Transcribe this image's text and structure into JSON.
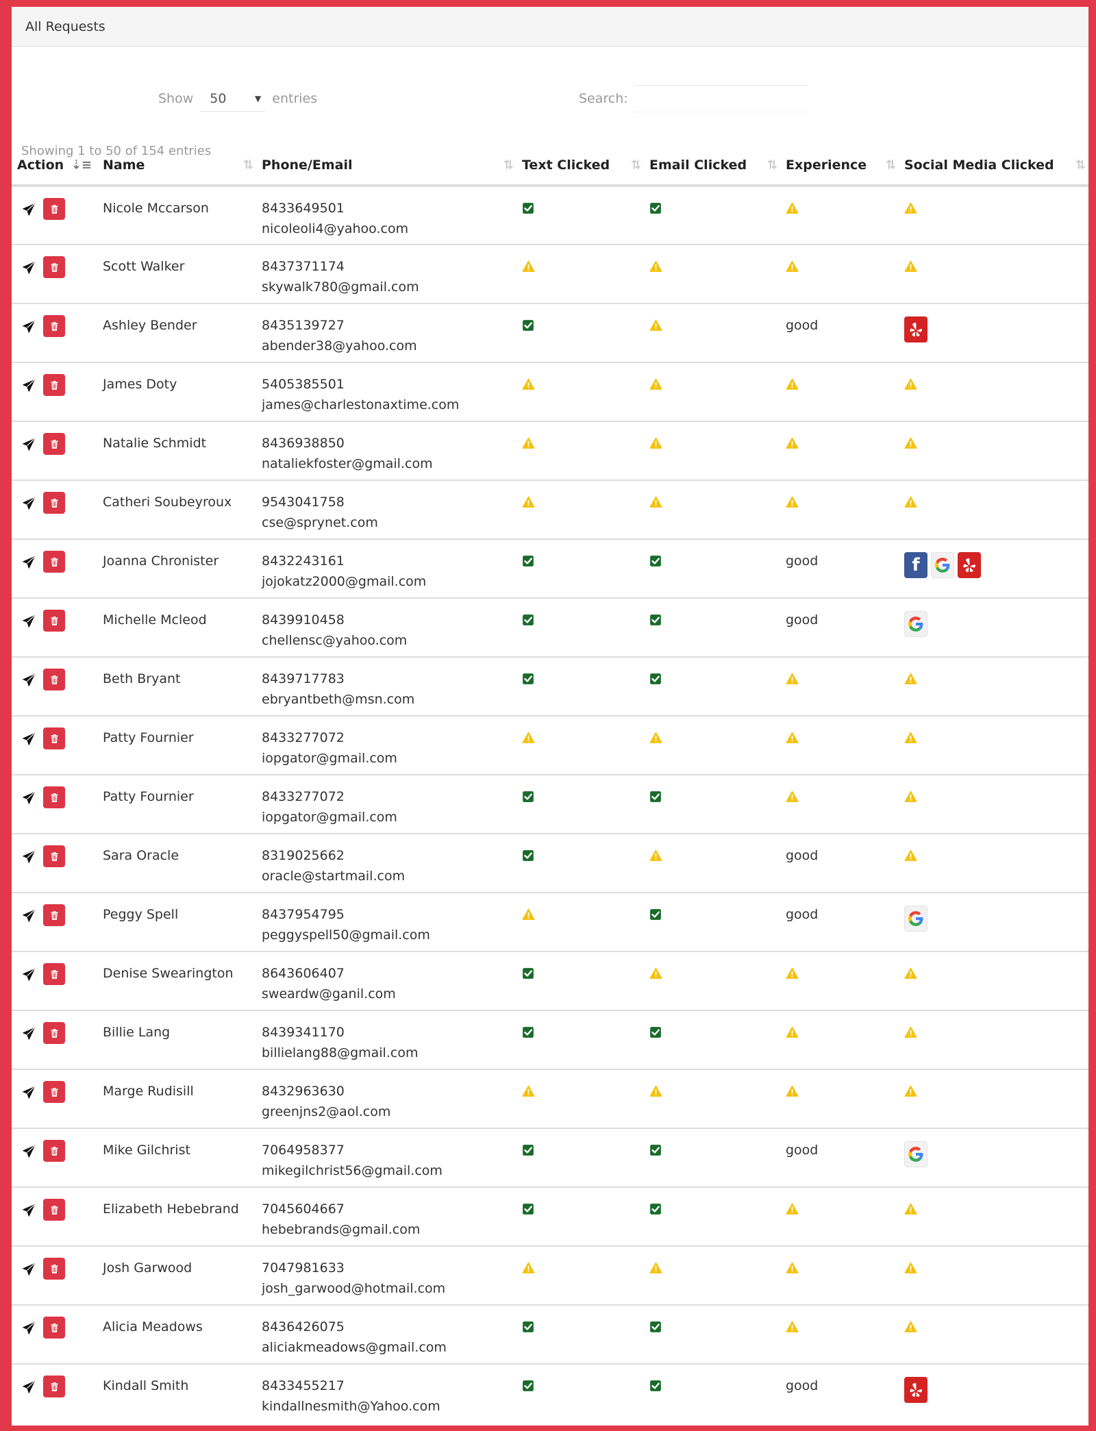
{
  "panel": {
    "title": "All Requests"
  },
  "controls": {
    "show_label": "Show",
    "length_value": "50",
    "entries_label": "entries",
    "search_label": "Search:",
    "search_value": "",
    "info": "Showing 1 to 50 of 154 entries"
  },
  "columns": [
    "Action",
    "Name",
    "Phone/Email",
    "Text Clicked",
    "Email Clicked",
    "Experience",
    "Social Media Clicked"
  ],
  "colors": {
    "frame": "#e2394a",
    "delete": "#dc3545",
    "check": "#1a6b2a",
    "warning": "#f4c20d",
    "yelp": "#d32323",
    "facebook": "#3b5998"
  },
  "rows": [
    {
      "name": "Nicole Mccarson",
      "phone": "8433649501",
      "email": "nicoleoli4@yahoo.com",
      "text": "check",
      "emailc": "check",
      "experience": "",
      "social": []
    },
    {
      "name": "Scott Walker",
      "phone": "8437371174",
      "email": "skywalk780@gmail.com",
      "text": "warn",
      "emailc": "warn",
      "experience": "",
      "social": []
    },
    {
      "name": "Ashley Bender",
      "phone": "8435139727",
      "email": "abender38@yahoo.com",
      "text": "check",
      "emailc": "warn",
      "experience": "good",
      "social": [
        "yelp"
      ]
    },
    {
      "name": "James Doty",
      "phone": "5405385501",
      "email": "james@charlestonaxtime.com",
      "text": "warn",
      "emailc": "warn",
      "experience": "",
      "social": []
    },
    {
      "name": "Natalie Schmidt",
      "phone": "8436938850",
      "email": "nataliekfoster@gmail.com",
      "text": "warn",
      "emailc": "warn",
      "experience": "",
      "social": []
    },
    {
      "name": "Catheri Soubeyroux",
      "phone": "9543041758",
      "email": "cse@sprynet.com",
      "text": "warn",
      "emailc": "warn",
      "experience": "",
      "social": []
    },
    {
      "name": "Joanna Chronister",
      "phone": "8432243161",
      "email": "jojokatz2000@gmail.com",
      "text": "check",
      "emailc": "check",
      "experience": "good",
      "social": [
        "facebook",
        "google",
        "yelp"
      ]
    },
    {
      "name": "Michelle Mcleod",
      "phone": "8439910458",
      "email": "chellensc@yahoo.com",
      "text": "check",
      "emailc": "check",
      "experience": "good",
      "social": [
        "google"
      ]
    },
    {
      "name": "Beth Bryant",
      "phone": "8439717783",
      "email": "ebryantbeth@msn.com",
      "text": "check",
      "emailc": "check",
      "experience": "",
      "social": []
    },
    {
      "name": "Patty Fournier",
      "phone": "8433277072",
      "email": "iopgator@gmail.com",
      "text": "warn",
      "emailc": "warn",
      "experience": "",
      "social": []
    },
    {
      "name": "Patty Fournier",
      "phone": "8433277072",
      "email": "iopgator@gmail.com",
      "text": "check",
      "emailc": "check",
      "experience": "",
      "social": []
    },
    {
      "name": "Sara Oracle",
      "phone": "8319025662",
      "email": "oracle@startmail.com",
      "text": "check",
      "emailc": "warn",
      "experience": "good",
      "social": []
    },
    {
      "name": "Peggy Spell",
      "phone": "8437954795",
      "email": "peggyspell50@gmail.com",
      "text": "warn",
      "emailc": "check",
      "experience": "good",
      "social": [
        "google"
      ]
    },
    {
      "name": "Denise Swearington",
      "phone": "8643606407",
      "email": "sweardw@ganil.com",
      "text": "check",
      "emailc": "warn",
      "experience": "",
      "social": []
    },
    {
      "name": "Billie Lang",
      "phone": "8439341170",
      "email": "billielang88@gmail.com",
      "text": "check",
      "emailc": "check",
      "experience": "",
      "social": []
    },
    {
      "name": "Marge Rudisill",
      "phone": "8432963630",
      "email": "greenjns2@aol.com",
      "text": "warn",
      "emailc": "warn",
      "experience": "",
      "social": []
    },
    {
      "name": "Mike Gilchrist",
      "phone": "7064958377",
      "email": "mikegilchrist56@gmail.com",
      "text": "check",
      "emailc": "check",
      "experience": "good",
      "social": [
        "google"
      ]
    },
    {
      "name": "Elizabeth Hebebrand",
      "phone": "7045604667",
      "email": "hebebrands@gmail.com",
      "text": "check",
      "emailc": "check",
      "experience": "",
      "social": []
    },
    {
      "name": "Josh Garwood",
      "phone": "7047981633",
      "email": "josh_garwood@hotmail.com",
      "text": "warn",
      "emailc": "warn",
      "experience": "",
      "social": []
    },
    {
      "name": "Alicia Meadows",
      "phone": "8436426075",
      "email": "aliciakmeadows@gmail.com",
      "text": "check",
      "emailc": "check",
      "experience": "",
      "social": []
    },
    {
      "name": "Kindall Smith",
      "phone": "8433455217",
      "email": "kindallnesmith@Yahoo.com",
      "text": "check",
      "emailc": "check",
      "experience": "good",
      "social": [
        "yelp"
      ]
    }
  ]
}
